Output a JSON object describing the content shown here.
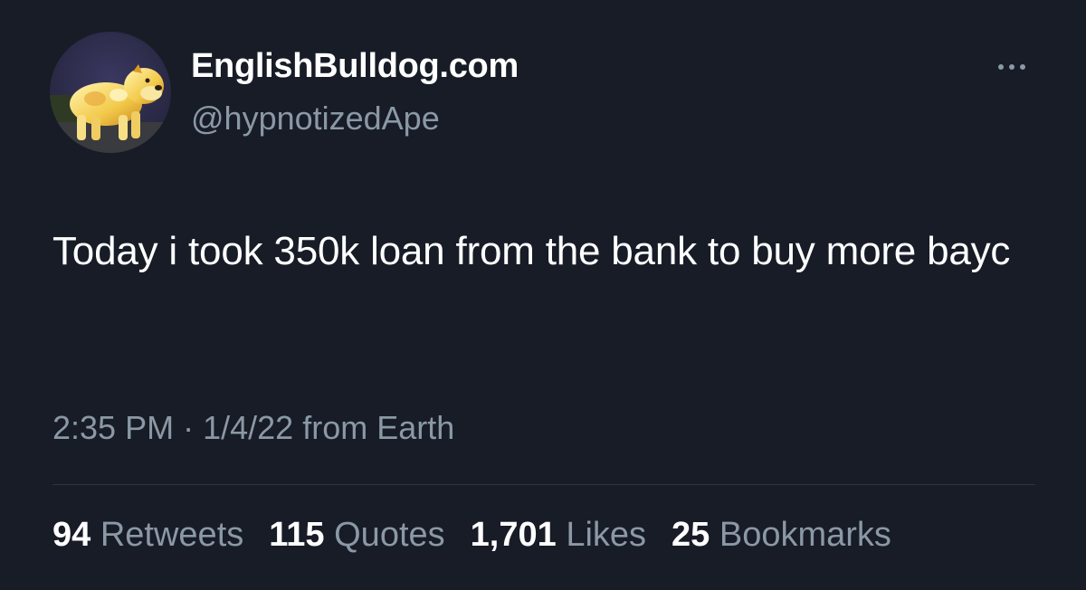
{
  "author": {
    "display_name": "EnglishBulldog.com",
    "handle": "@hypnotizedApe",
    "avatar_icon": "bulldog-avatar-icon"
  },
  "tweet": {
    "text": "Today i took 350k loan from the bank to buy more bayc"
  },
  "meta": {
    "time": "2:35 PM",
    "separator": "·",
    "date": "1/4/22",
    "source": "from Earth"
  },
  "stats": [
    {
      "count": "94",
      "label": "Retweets"
    },
    {
      "count": "115",
      "label": "Quotes"
    },
    {
      "count": "1,701",
      "label": "Likes"
    },
    {
      "count": "25",
      "label": "Bookmarks"
    }
  ],
  "more_icon": "more-dots-icon",
  "colors": {
    "background": "#171c27",
    "primary_text": "#ffffff",
    "secondary_text": "#8b98a5",
    "divider": "#2f3640"
  }
}
